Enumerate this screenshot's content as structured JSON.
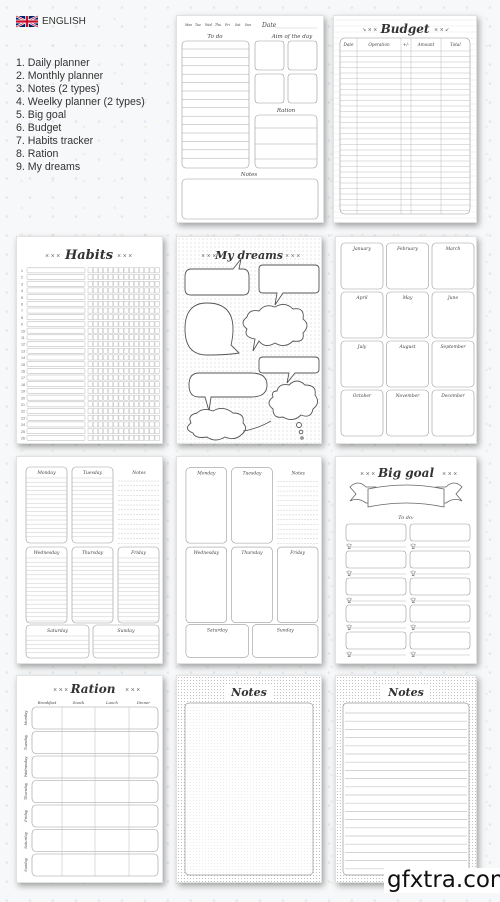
{
  "header": {
    "language_label": "ENGLISH",
    "flag_icon": "uk-flag-icon",
    "contents": [
      "1. Daily planner",
      "2. Monthly planner",
      "3. Notes (2 types)",
      "4. Weelky planner (2 types)",
      "5. Big goal",
      "6. Budget",
      "7. Habits tracker",
      "8. Ration",
      "9. My dreams"
    ]
  },
  "pages": {
    "daily": {
      "weekdays": [
        "Mon",
        "Tue",
        "Wed",
        "Thu",
        "Fri",
        "Sat",
        "Sun"
      ],
      "date_label": "Date",
      "todo_label": "To do",
      "aim_label": "Aim of the day",
      "ration_label": "Ration",
      "notes_label": "Notes"
    },
    "budget": {
      "title": "Budget",
      "columns": [
        "Date",
        "Operation",
        "+/-",
        "Amount",
        "Total"
      ]
    },
    "habits": {
      "title": "Habits",
      "row_numbers": [
        "1",
        "2",
        "3",
        "4",
        "5",
        "6",
        "7",
        "8",
        "9",
        "10",
        "11",
        "12",
        "13",
        "14",
        "15",
        "16",
        "17",
        "18",
        "19",
        "20",
        "21",
        "22",
        "23",
        "24",
        "25",
        "26"
      ]
    },
    "dreams": {
      "title": "My dreams"
    },
    "monthly": {
      "months": [
        "January",
        "February",
        "March",
        "April",
        "May",
        "June",
        "July",
        "August",
        "September",
        "October",
        "November",
        "December"
      ]
    },
    "weekly": {
      "days": [
        "Monday",
        "Tuesday",
        "Wednesday",
        "Thursday",
        "Friday",
        "Saturday",
        "Sunday"
      ],
      "notes_label": "Notes"
    },
    "big_goal": {
      "title": "Big goal",
      "todo_label": "To do:"
    },
    "ration": {
      "title": "Ration",
      "meals": [
        "Breakfast",
        "Snack",
        "Lunch",
        "Dinner"
      ],
      "days": [
        "Monday",
        "Tuesday",
        "Wednesday",
        "Thursday",
        "Friday",
        "Saturday",
        "Sunday"
      ]
    },
    "notes_dotted": {
      "title": "Notes"
    },
    "notes_lined": {
      "title": "Notes"
    }
  },
  "watermark": "gfxtra.com"
}
